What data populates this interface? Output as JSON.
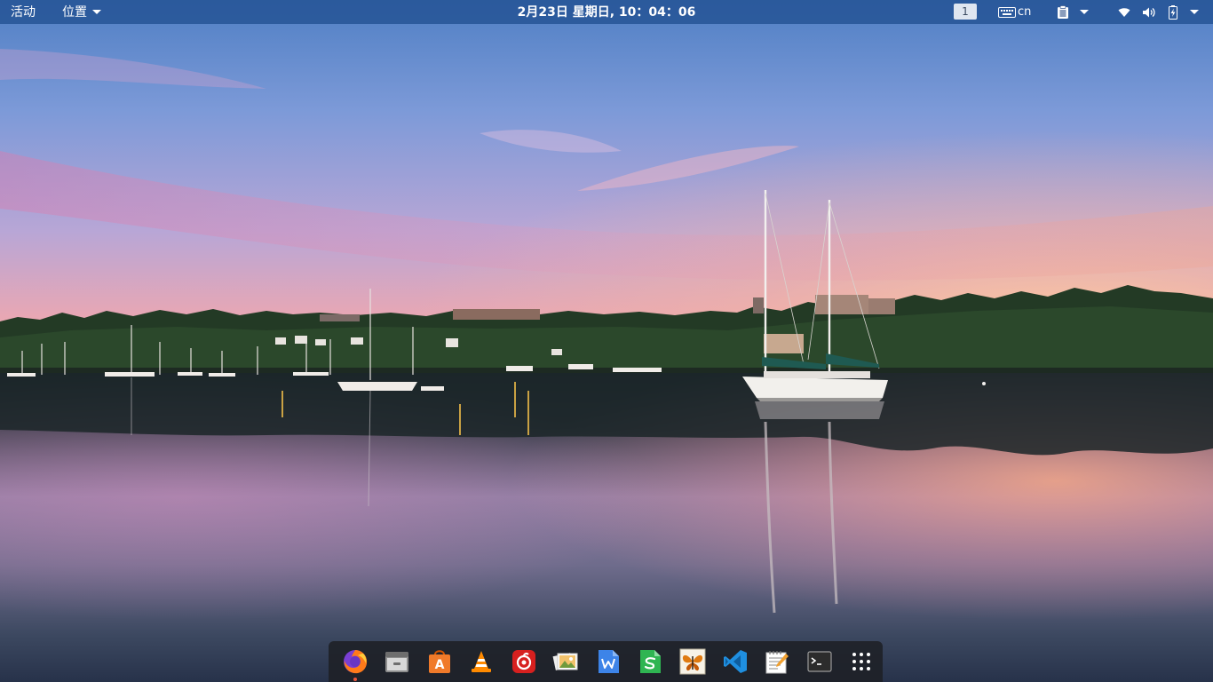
{
  "topbar": {
    "activities_label": "活动",
    "places_label": "位置",
    "clock": "2月23日 星期日, 10：04：06",
    "workspace_number": "1",
    "keyboard_layout": "cn",
    "icons": {
      "keyboard": "keyboard-icon",
      "clipboard": "clipboard-icon",
      "wifi": "wifi-icon",
      "volume": "volume-icon",
      "battery": "battery-charging-icon",
      "system_menu": "chevron-down-icon"
    }
  },
  "dock": {
    "items": [
      {
        "name": "Firefox",
        "icon": "firefox-icon",
        "running": true
      },
      {
        "name": "Files",
        "icon": "files-icon",
        "running": false
      },
      {
        "name": "Ubuntu Software",
        "icon": "software-store-icon",
        "running": false
      },
      {
        "name": "VLC",
        "icon": "vlc-icon",
        "running": false
      },
      {
        "name": "NetEase Music",
        "icon": "netease-music-icon",
        "running": false
      },
      {
        "name": "Image Viewer",
        "icon": "image-viewer-icon",
        "running": false
      },
      {
        "name": "WPS Writer",
        "icon": "wps-writer-icon",
        "running": false
      },
      {
        "name": "WPS Spreadsheets",
        "icon": "wps-spreadsheets-icon",
        "running": false
      },
      {
        "name": "Butterfly App",
        "icon": "butterfly-icon",
        "running": false
      },
      {
        "name": "Visual Studio Code",
        "icon": "vscode-icon",
        "running": false
      },
      {
        "name": "Text Editor",
        "icon": "text-editor-icon",
        "running": false
      },
      {
        "name": "Terminal",
        "icon": "terminal-icon",
        "running": false
      },
      {
        "name": "Show Applications",
        "icon": "app-grid-icon",
        "running": false
      }
    ]
  },
  "colors": {
    "topbar_bg": "#235294",
    "dock_bg": "#1e2026",
    "running_indicator": "#e8553c"
  }
}
